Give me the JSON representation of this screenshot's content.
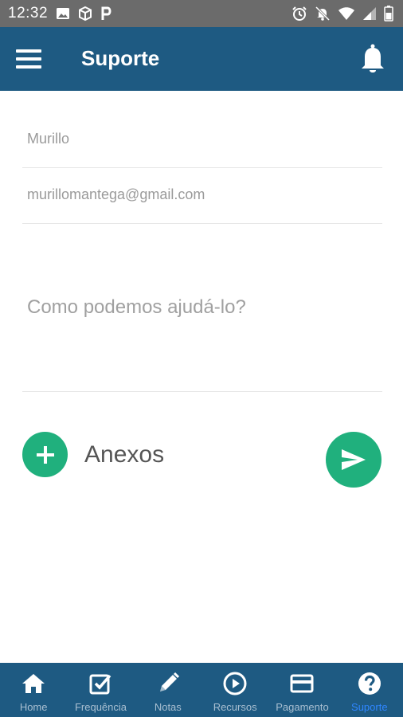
{
  "status_bar": {
    "time": "12:32",
    "left_icons": [
      "image-icon",
      "cube-icon",
      "parking-icon"
    ],
    "right_icons": [
      "alarm-icon",
      "notifications-off-icon",
      "wifi-icon",
      "signal-icon",
      "battery-icon"
    ]
  },
  "app_bar": {
    "title": "Suporte",
    "menu_icon": "hamburger-menu-icon",
    "notification_icon": "bell-icon",
    "background": "#1e5a82"
  },
  "form": {
    "name_value": "Murillo",
    "email_value": "murillomantega@gmail.com",
    "message_placeholder": "Como podemos ajudá-lo?",
    "attachments_label": "Anexos"
  },
  "colors": {
    "accent": "#20b07d",
    "nav_active": "#2f86ff",
    "primary": "#1e5a82"
  },
  "bottom_nav": {
    "items": [
      {
        "label": "Home",
        "icon": "home-icon"
      },
      {
        "label": "Frequência",
        "icon": "checkbox-icon"
      },
      {
        "label": "Notas",
        "icon": "pencil-icon"
      },
      {
        "label": "Recursos",
        "icon": "play-circle-icon"
      },
      {
        "label": "Pagamento",
        "icon": "credit-card-icon"
      },
      {
        "label": "Suporte",
        "icon": "help-circle-icon"
      }
    ],
    "active": "Suporte"
  }
}
